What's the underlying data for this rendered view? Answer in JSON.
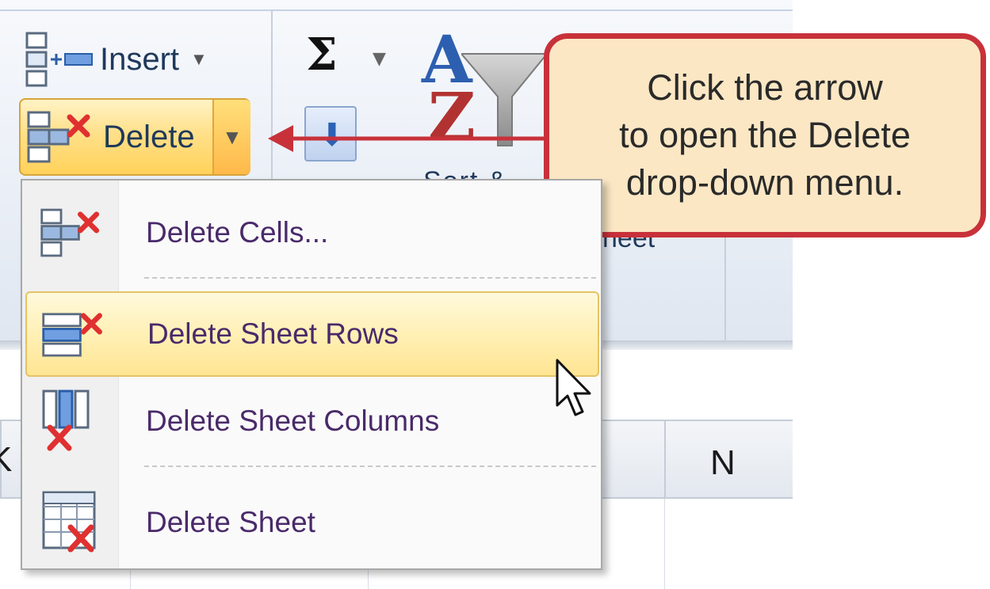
{
  "ribbon": {
    "insert_label": "Insert",
    "delete_label": "Delete",
    "sort_label_partial": "Sort & ",
    "sheet_label_partial": "heet",
    "icons": {
      "insert": "insert-cells-icon",
      "delete": "delete-cells-icon",
      "autosum": "sigma-icon",
      "fill": "fill-down-icon",
      "sort_filter": "sort-filter-icon"
    }
  },
  "callout": {
    "lines": [
      "Click the arrow",
      "to open the Delete",
      "drop-down menu."
    ],
    "border_color": "#c8313a",
    "fill_color": "#fbe7c4"
  },
  "menu": {
    "items": [
      {
        "label": "Delete Cells...",
        "icon": "delete-cells-icon"
      },
      {
        "label": "Delete Sheet Rows",
        "icon": "delete-rows-icon",
        "highlighted": true
      },
      {
        "label": "Delete Sheet Columns",
        "icon": "delete-columns-icon"
      },
      {
        "label": "Delete Sheet",
        "icon": "delete-sheet-icon"
      }
    ]
  },
  "columns": {
    "left_partial": "K",
    "right": "N"
  },
  "colors": {
    "accent_red": "#c8313a",
    "highlight_gold": "#ffd25a",
    "menu_text": "#4a2a6a"
  }
}
